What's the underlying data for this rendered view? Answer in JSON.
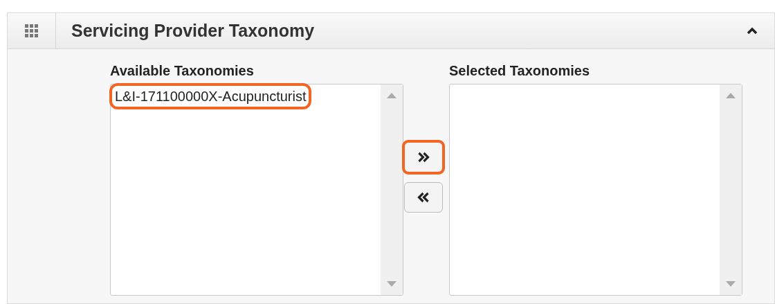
{
  "panel": {
    "title": "Servicing Provider Taxonomy",
    "expanded": true
  },
  "available": {
    "label": "Available Taxonomies",
    "options": [
      {
        "text": "L&I-171100000X-Acupuncturist",
        "highlighted": true
      }
    ]
  },
  "transfer_buttons": [
    {
      "kind": "add",
      "highlighted": true
    },
    {
      "kind": "remove",
      "highlighted": false
    }
  ],
  "selected": {
    "label": "Selected Taxonomies"
  }
}
